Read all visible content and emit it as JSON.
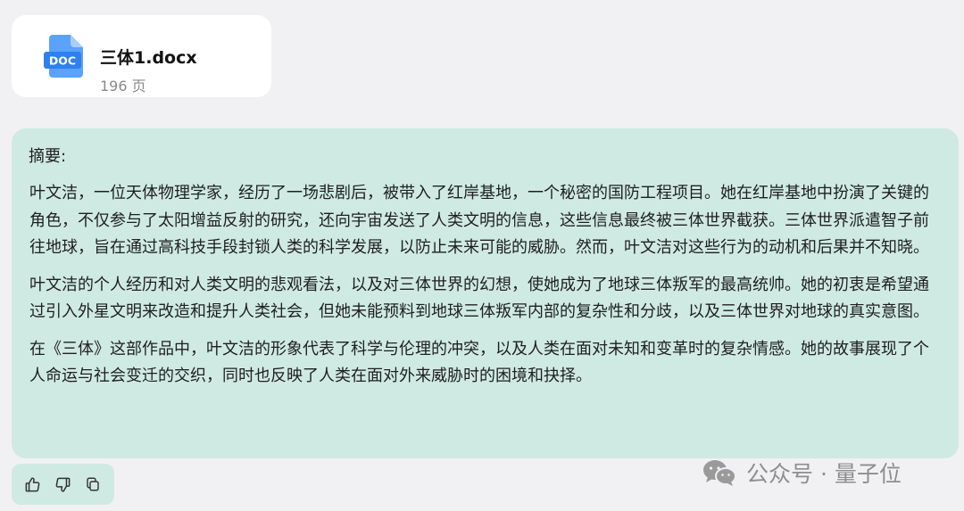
{
  "attachment": {
    "file_name": "三体1.docx",
    "pages": "196 页",
    "icon_label": "DOC",
    "icon_color": "#3d8ef8"
  },
  "summary": {
    "heading": "摘要:",
    "paragraphs": [
      "叶文洁，一位天体物理学家，经历了一场悲剧后，被带入了红岸基地，一个秘密的国防工程项目。她在红岸基地中扮演了关键的角色，不仅参与了太阳增益反射的研究，还向宇宙发送了人类文明的信息，这些信息最终被三体世界截获。三体世界派遣智子前往地球，旨在通过高科技手段封锁人类的科学发展，以防止未来可能的威胁。然而，叶文洁对这些行为的动机和后果并不知晓。",
      "叶文洁的个人经历和对人类文明的悲观看法，以及对三体世界的幻想，使她成为了地球三体叛军的最高统帅。她的初衷是希望通过引入外星文明来改造和提升人类社会，但她未能预料到地球三体叛军内部的复杂性和分歧，以及三体世界对地球的真实意图。",
      "在《三体》这部作品中，叶文洁的形象代表了科学与伦理的冲突，以及人类在面对未知和变革时的复杂情感。她的故事展现了个人命运与社会变迁的交织，同时也反映了人类在面对外来威胁时的困境和抉择。"
    ],
    "background_color": "#cfeae3"
  },
  "actions": {
    "icons": [
      "thumbs-up-icon",
      "thumbs-down-icon",
      "copy-icon"
    ]
  },
  "watermark": {
    "text": "公众号 · 量子位"
  }
}
